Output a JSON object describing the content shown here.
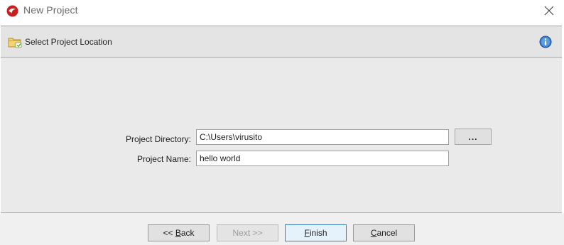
{
  "window": {
    "title": "New Project",
    "close_icon": "close-icon",
    "app_icon": "app-logo-icon"
  },
  "header": {
    "title": "Select Project Location",
    "folder_icon": "folder-new-icon",
    "info_icon": "info-icon"
  },
  "form": {
    "directory": {
      "label": "Project Directory:",
      "value": "C:\\Users\\virusito"
    },
    "name": {
      "label": "Project Name:",
      "value": "hello world"
    },
    "browse_label": "..."
  },
  "buttons": {
    "back": {
      "prefix": "<< ",
      "mnemonic": "B",
      "rest": "ack",
      "enabled": true
    },
    "next": {
      "text": "Next >>",
      "enabled": false
    },
    "finish": {
      "mnemonic": "F",
      "rest": "inish",
      "enabled": true,
      "default": true
    },
    "cancel": {
      "mnemonic": "C",
      "rest": "ancel",
      "enabled": true
    }
  },
  "colors": {
    "header_bg": "#e4e4e4",
    "content_bg": "#eaeaea",
    "accent_border": "#3c7fb1",
    "info_blue": "#2f6fb8",
    "app_icon_red": "#c81e1e"
  }
}
